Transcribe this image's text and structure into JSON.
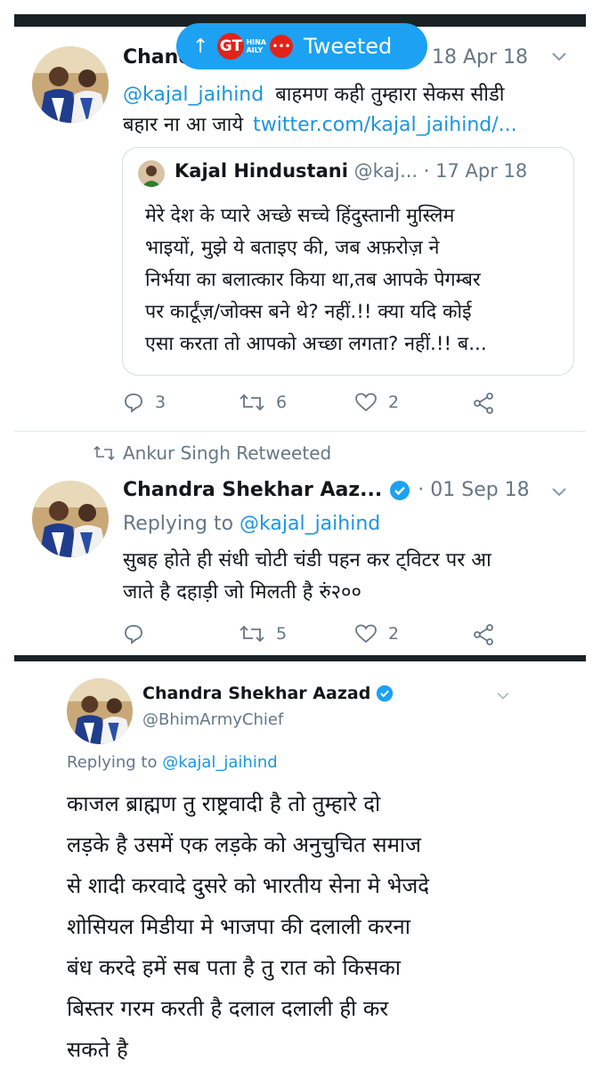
{
  "toast": {
    "arrow": "↑",
    "label": "Tweeted",
    "logo_gt": "GT",
    "logo_china": "HINA",
    "logo_daily": "AILY"
  },
  "tweet1": {
    "author": "Chand",
    "date": "18 Apr 18",
    "mention": "@kajal_jaihind",
    "text_line1": "बाहमण कही तुम्हारा सेकस सीडी",
    "text_line2_start": "बहार ना आ जाये",
    "link": "twitter.com/kajal_jaihind/...",
    "quote": {
      "author": "Kajal Hindustani",
      "handle": "@kaj...",
      "date": "· 17 Apr 18",
      "lines": [
        "मेरे देश के प्यारे अच्छे सच्चे हिंदुस्तानी मुस्लिम",
        "भाइयों, मुझे ये बताइए की, जब अफ़रोज़ ने",
        "निर्भया का बलात्कार किया था,तब आपके पेगम्बर",
        "पर कार्टूंज़/जोक्स बने थे? नहीं.!! क्या यदि कोई",
        "एसा करता तो आपको अच्छा लगता? नहीं.!! ब..."
      ]
    },
    "replies": "3",
    "retweets": "6",
    "likes": "2"
  },
  "tweet2": {
    "retweeted_by": "Ankur Singh Retweeted",
    "author": "Chandra Shekhar Aaz...",
    "date": "· 01 Sep 18",
    "replying_prefix": "Replying to",
    "replying_handle": "@kajal_jaihind",
    "text_line1": "सुबह होते ही संधी चोटी चंडी पहन कर ट्विटर पर आ",
    "text_line2": "जाते है दहाड़ी जो मिलती है रुं२००",
    "replies": "",
    "retweets": "5",
    "likes": "2"
  },
  "tweet3": {
    "author": "Chandra Shekhar Aazad",
    "handle": "@BhimArmyChief",
    "replying_prefix": "Replying to",
    "replying_handle": "@kajal_jaihind",
    "lines": [
      "काजल ब्राह्मण तु राष्ट्रवादी है तो तुम्हारे दो",
      "लड़के है उसमें एक लड़के को अनुचुचित समाज",
      "से शादी करवादे दुसरे को भारतीय सेना मे भेजदे",
      "शोसियल मिडीया मे भाजपा की दलाली करना",
      "बंध करदे हमें सब पता है तु रात को किसका",
      "बिस्तर गरम करती है दलाल दलाली ही कर",
      "सकते है"
    ]
  },
  "colors": {
    "accent": "#1da1f2",
    "link": "#1b95e0",
    "muted": "#657786",
    "bar": "#1a2226"
  }
}
